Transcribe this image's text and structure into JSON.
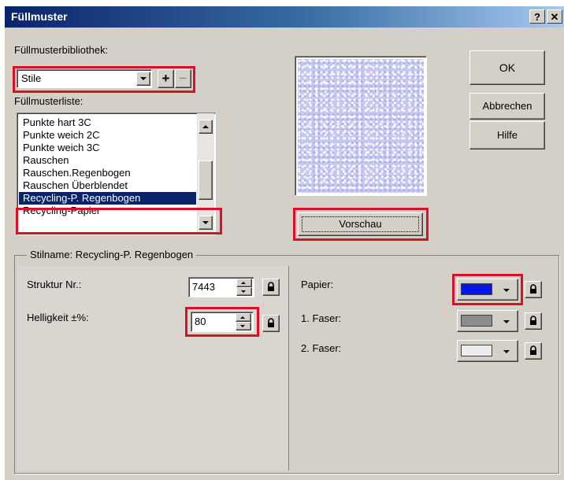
{
  "dialog": {
    "title": "Füllmuster",
    "help_label": "?",
    "close_label": "✕"
  },
  "library": {
    "label": "Füllmusterbibliothek:",
    "selected": "Stile",
    "add_label": "+",
    "remove_label": "−"
  },
  "pattern_list": {
    "label": "Füllmusterliste:",
    "items": [
      "Punkte hart 3C",
      "Punkte weich 2C",
      "Punkte weich 3C",
      "Rauschen",
      "Rauschen.Regenbogen",
      "Rauschen Überblendet"
    ],
    "selected": "Recycling-P. Regenbogen",
    "partial": "Recycling-Papier"
  },
  "buttons": {
    "ok": "OK",
    "cancel": "Abbrechen",
    "help": "Hilfe",
    "preview": "Vorschau"
  },
  "style_group": {
    "title": "Stilname: Recycling-P. Regenbogen",
    "structure_label": "Struktur Nr.:",
    "structure_value": "7443",
    "brightness_label": "Helligkeit ±%:",
    "brightness_value": "80",
    "paper_label": "Papier:",
    "fiber1_label": "1. Faser:",
    "fiber2_label": "2. Faser:"
  },
  "colors": {
    "paper": "#0a14e6",
    "fiber1": "#8c8c8c",
    "fiber2": "#ececec",
    "highlight": "#d8102a",
    "selection": "#0a246a"
  },
  "icons": {
    "lock": "lock-icon",
    "dropdown": "chevron-down-icon",
    "spin": "spinner-arrows-icon"
  }
}
